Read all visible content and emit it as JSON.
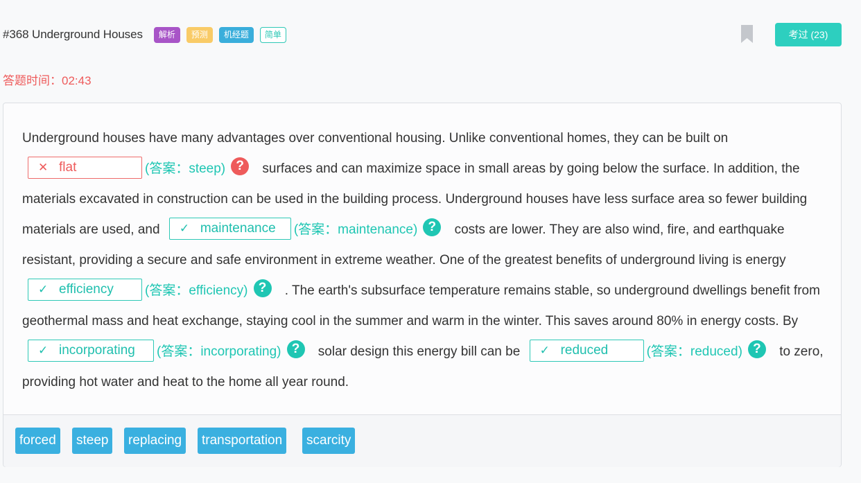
{
  "question": {
    "title": "#368 Underground Houses",
    "tags": [
      "解析",
      "预测",
      "机经题",
      "简单"
    ]
  },
  "passed_button": "考过 (23)",
  "timer": "答题时间：02:43",
  "passage": {
    "t1": "Underground houses have many advantages over conventional housing. Unlike conventional homes, they can be built on",
    "t2": "surfaces and can maximize space in small areas by going below the surface. In addition, the materials excavated in construction can be used in the building process. Underground houses have less surface area so fewer building materials are used, and",
    "t3": "costs are lower. They are also wind, fire, and earthquake resistant, providing a secure and safe environment in extreme weather. One of the greatest benefits of underground living is energy",
    "t4": ". The earth's subsurface temperature remains stable, so underground dwellings benefit from geothermal mass and heat exchange, staying cool in the summer and warm in the winter. This saves around 80% in energy costs. By",
    "t5": "solar design this energy bill can be",
    "t6": "to zero, providing hot water and heat to the home all year round."
  },
  "blanks": [
    {
      "mark": "✕",
      "value": "flat",
      "answer": "(答案：steep)",
      "status": "wrong"
    },
    {
      "mark": "✓",
      "value": "maintenance",
      "answer": "(答案：maintenance)",
      "status": "right"
    },
    {
      "mark": "✓",
      "value": "efficiency",
      "answer": "(答案：efficiency)",
      "status": "right"
    },
    {
      "mark": "✓",
      "value": "incorporating",
      "answer": "(答案：incorporating)",
      "status": "right"
    },
    {
      "mark": "✓",
      "value": "reduced",
      "answer": "(答案：reduced)",
      "status": "right"
    }
  ],
  "help_glyph": "?",
  "word_bank": [
    "forced",
    "steep",
    "replacing",
    "transportation",
    "scarcity"
  ],
  "colors": {
    "accent_teal": "#2dcfbf",
    "error_red": "#ee5b5b",
    "word_blue": "#3ab0e0",
    "tag_purple": "#a855c7",
    "tag_yellow": "#f9cb67",
    "tag_blue": "#3aaedb"
  },
  "icons": {
    "bookmark": "bookmark-icon",
    "wrong": "cross-icon",
    "right": "check-icon",
    "help": "question-circle-icon"
  }
}
